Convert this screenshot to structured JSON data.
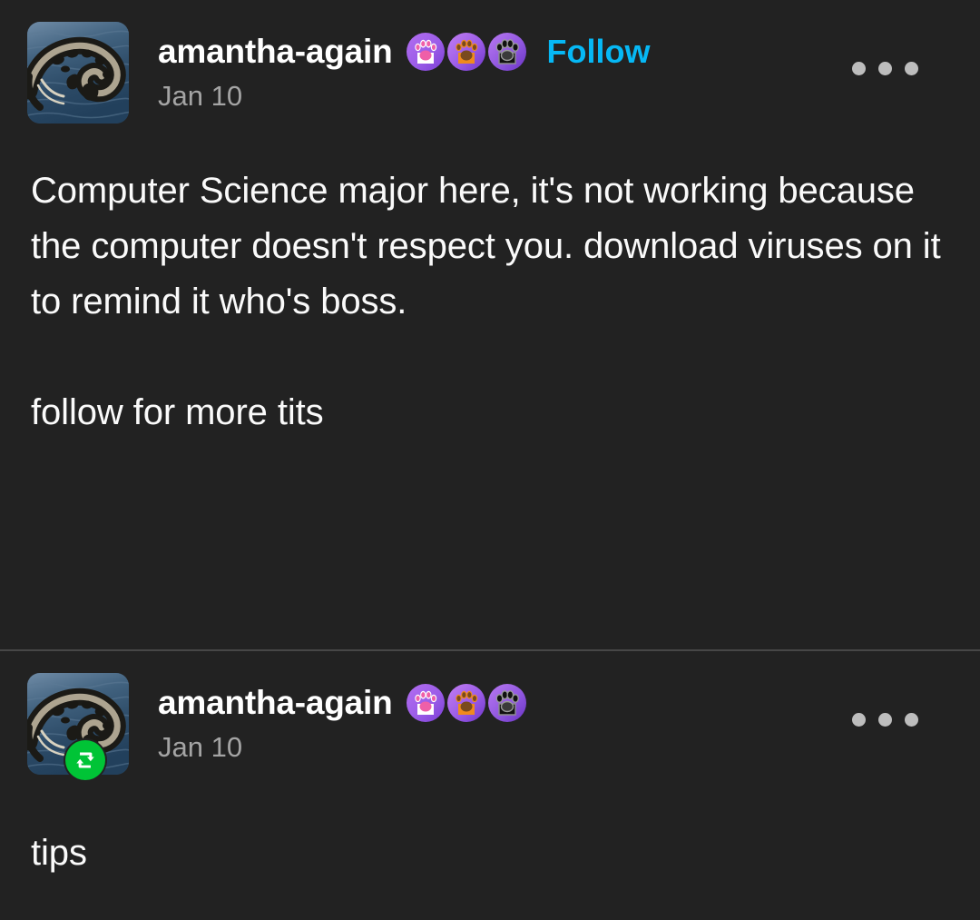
{
  "theme": {
    "background": "#222222",
    "text_primary": "#fafafa",
    "text_secondary": "#a4a4a4",
    "link_accent": "#06b8f5",
    "reblog_green": "#00c436",
    "divider": "#474747"
  },
  "posts": [
    {
      "username": "amantha-again",
      "timestamp": "Jan 10",
      "follow_label": "Follow",
      "has_follow": true,
      "is_reblog": false,
      "badges": [
        {
          "name": "white-paw-badge",
          "paw": "#ffffff",
          "pad": "#ef5fa8"
        },
        {
          "name": "orange-paw-badge",
          "paw": "#f08a1e",
          "pad": "#7a4a1d"
        },
        {
          "name": "black-paw-badge",
          "paw": "#111111",
          "pad": "#8e8e8e"
        }
      ],
      "overflow_label": "More options",
      "paragraphs": [
        "Computer Science major here, it's not working because the computer doesn't respect you. download viruses on it to remind it who's boss.",
        "follow for more tits"
      ]
    },
    {
      "username": "amantha-again",
      "timestamp": "Jan 10",
      "follow_label": "",
      "has_follow": false,
      "is_reblog": true,
      "badges": [
        {
          "name": "white-paw-badge",
          "paw": "#ffffff",
          "pad": "#ef5fa8"
        },
        {
          "name": "orange-paw-badge",
          "paw": "#f08a1e",
          "pad": "#7a4a1d"
        },
        {
          "name": "black-paw-badge",
          "paw": "#111111",
          "pad": "#8e8e8e"
        }
      ],
      "overflow_label": "More options",
      "paragraphs": [
        "tips"
      ]
    }
  ],
  "icons": {
    "avatar_alt": "catfish-avatar",
    "reblog": "reblog-icon",
    "overflow": "overflow-menu-icon"
  }
}
